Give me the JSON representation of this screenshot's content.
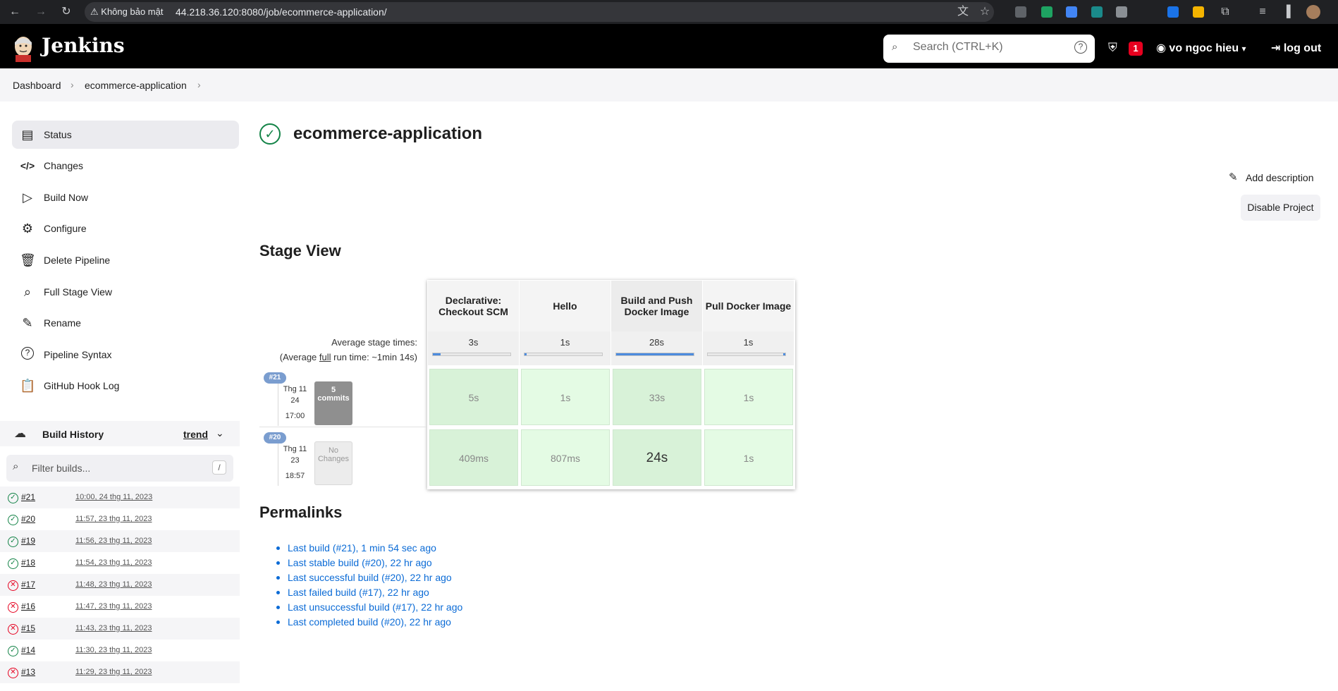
{
  "browser": {
    "security_label": "Không bảo mật",
    "url": "44.218.36.120:8080/job/ecommerce-application/"
  },
  "header": {
    "logo_text": "Jenkins",
    "search_placeholder": "Search (CTRL+K)",
    "security_count": "1",
    "user_name": "vo ngoc hieu",
    "logout_label": "log out"
  },
  "breadcrumb": [
    "Dashboard",
    "ecommerce-application"
  ],
  "sidebar": {
    "items": [
      {
        "label": "Status",
        "icon": "status-icon"
      },
      {
        "label": "Changes",
        "icon": "code-icon"
      },
      {
        "label": "Build Now",
        "icon": "play-icon"
      },
      {
        "label": "Configure",
        "icon": "gear-icon"
      },
      {
        "label": "Delete Pipeline",
        "icon": "trash-icon"
      },
      {
        "label": "Full Stage View",
        "icon": "search-icon"
      },
      {
        "label": "Rename",
        "icon": "pencil-icon"
      },
      {
        "label": "Pipeline Syntax",
        "icon": "help-icon"
      },
      {
        "label": "GitHub Hook Log",
        "icon": "clipboard-icon"
      }
    ]
  },
  "build_history": {
    "title": "Build History",
    "trend_label": "trend",
    "filter_placeholder": "Filter builds...",
    "filter_shortcut": "/",
    "builds": [
      {
        "number": "#21",
        "date": "10:00, 24 thg 11, 2023",
        "status": "success"
      },
      {
        "number": "#20",
        "date": "11:57, 23 thg 11, 2023",
        "status": "success"
      },
      {
        "number": "#19",
        "date": "11:56, 23 thg 11, 2023",
        "status": "success"
      },
      {
        "number": "#18",
        "date": "11:54, 23 thg 11, 2023",
        "status": "success"
      },
      {
        "number": "#17",
        "date": "11:48, 23 thg 11, 2023",
        "status": "failed"
      },
      {
        "number": "#16",
        "date": "11:47, 23 thg 11, 2023",
        "status": "failed"
      },
      {
        "number": "#15",
        "date": "11:43, 23 thg 11, 2023",
        "status": "failed"
      },
      {
        "number": "#14",
        "date": "11:30, 23 thg 11, 2023",
        "status": "success"
      },
      {
        "number": "#13",
        "date": "11:29, 23 thg 11, 2023",
        "status": "failed"
      }
    ]
  },
  "main": {
    "title": "ecommerce-application",
    "add_description": "Add description",
    "disable_project": "Disable Project"
  },
  "stage_view": {
    "title": "Stage View",
    "avg_label": "Average stage times:",
    "avg_full_prefix": "(Average ",
    "avg_full_link": "full",
    "avg_full_suffix": " run time: ~1min 14s)",
    "stages": [
      {
        "name": "Declarative: Checkout SCM",
        "avg": "3s",
        "avg_fraction": 0.1
      },
      {
        "name": "Hello",
        "avg": "1s",
        "avg_fraction": 0.03
      },
      {
        "name": "Build and Push Docker Image",
        "avg": "28s",
        "avg_fraction": 1.0
      },
      {
        "name": "Pull Docker Image",
        "avg": "1s",
        "avg_fraction": 0.03
      }
    ],
    "runs": [
      {
        "badge": "#21",
        "date_line1": "Thg 11",
        "date_line2": "24",
        "time": "17:00",
        "commits_line1": "5",
        "commits_line2": "commits",
        "cells": [
          "5s",
          "1s",
          "33s",
          "1s"
        ]
      },
      {
        "badge": "#20",
        "date_line1": "Thg 11",
        "date_line2": "23",
        "time": "18:57",
        "commits_line1": "No",
        "commits_line2": "Changes",
        "cells": [
          "409ms",
          "807ms",
          "24s",
          "1s"
        ]
      }
    ]
  },
  "permalinks": {
    "title": "Permalinks",
    "items": [
      "Last build (#21), 1 min 54 sec ago",
      "Last stable build (#20), 22 hr ago",
      "Last successful build (#20), 22 hr ago",
      "Last failed build (#17), 22 hr ago",
      "Last unsuccessful build (#17), 22 hr ago",
      "Last completed build (#20), 22 hr ago"
    ]
  },
  "colors": {
    "success": "#138347",
    "failure": "#e6001f",
    "link": "#0b6bd6",
    "stage_bar": "#4c8bdd"
  }
}
